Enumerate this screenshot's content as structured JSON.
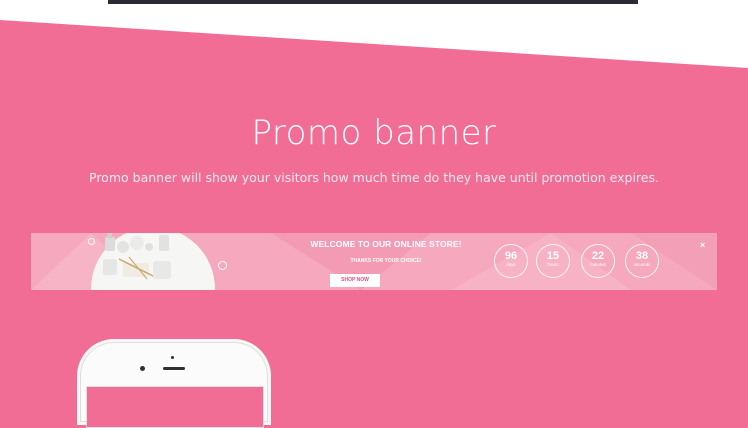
{
  "section": {
    "title": "Promo banner",
    "description": "Promo banner will show your visitors how much time do they have until promotion expires."
  },
  "banner": {
    "heading": "WELCOME TO OUR ONLINE STORE!",
    "subheading": "THANKS FOR YOUR CHOICE!",
    "button_label": "SHOP NOW",
    "close_symbol": "×",
    "timers": [
      {
        "value": "96",
        "unit": "days"
      },
      {
        "value": "15",
        "unit": "hours"
      },
      {
        "value": "22",
        "unit": "minutes"
      },
      {
        "value": "38",
        "unit": "seconds"
      }
    ]
  },
  "colors": {
    "background": "#f26d95",
    "banner": "#f5a8be",
    "button_text": "#e94f7e"
  }
}
